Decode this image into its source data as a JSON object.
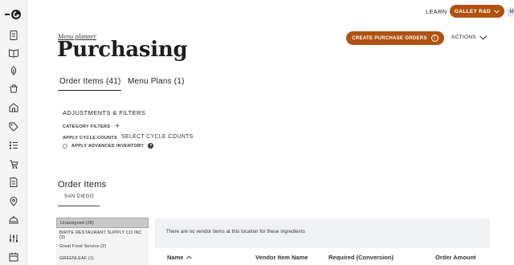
{
  "topbar": {
    "learn_label": "LEARN",
    "account_label": "GALLEY R&D",
    "avatar_initial": "M"
  },
  "header": {
    "breadcrumb": "Menu planner",
    "title": "Purchasing",
    "create_button_label": "CREATE PURCHASE ORDERS",
    "actions_label": "ACTIONS"
  },
  "tabs": [
    {
      "label": "Order Items (41)",
      "active": true
    },
    {
      "label": "Menu Plans (1)",
      "active": false
    }
  ],
  "adjustments": {
    "title": "ADJUSTMENTS & FILTERS",
    "category_filters_label": "CATEGORY FILTERS",
    "cycle_counts_label": "APPLY CYCLE COUNTS",
    "cycle_counts_select": "SELECT CYCLE COUNTS",
    "advanced_inventory_label": "APPLY ADVANCED INVENTORY"
  },
  "order_items": {
    "title": "Order Items",
    "location_tab": "SAN DIEGO",
    "vendors": [
      {
        "label": "Unassigned (28)",
        "selected": true
      },
      {
        "label": "BIRITE RESTAURANT SUPPLY CO INC (3)",
        "selected": false
      },
      {
        "label": "Great Food Service (2)",
        "selected": false
      },
      {
        "label": "GREENLEAF (1)",
        "selected": false
      }
    ],
    "empty_message": "There are no vendor items at this location for these ingredients",
    "columns": [
      "Name",
      "Vendor Item Name",
      "Required (Conversion)",
      "Order Amount"
    ]
  },
  "colors": {
    "accent": "#b05210",
    "rail_bg": "#f4f4f5"
  },
  "rail_icons": [
    "recipes-icon",
    "book-icon",
    "ingredient-icon",
    "cart-icon",
    "store-icon",
    "tag-icon",
    "list-icon",
    "order-icon",
    "document-icon",
    "location-icon",
    "dining-icon",
    "settings-sliders-icon",
    "calendar-icon"
  ]
}
